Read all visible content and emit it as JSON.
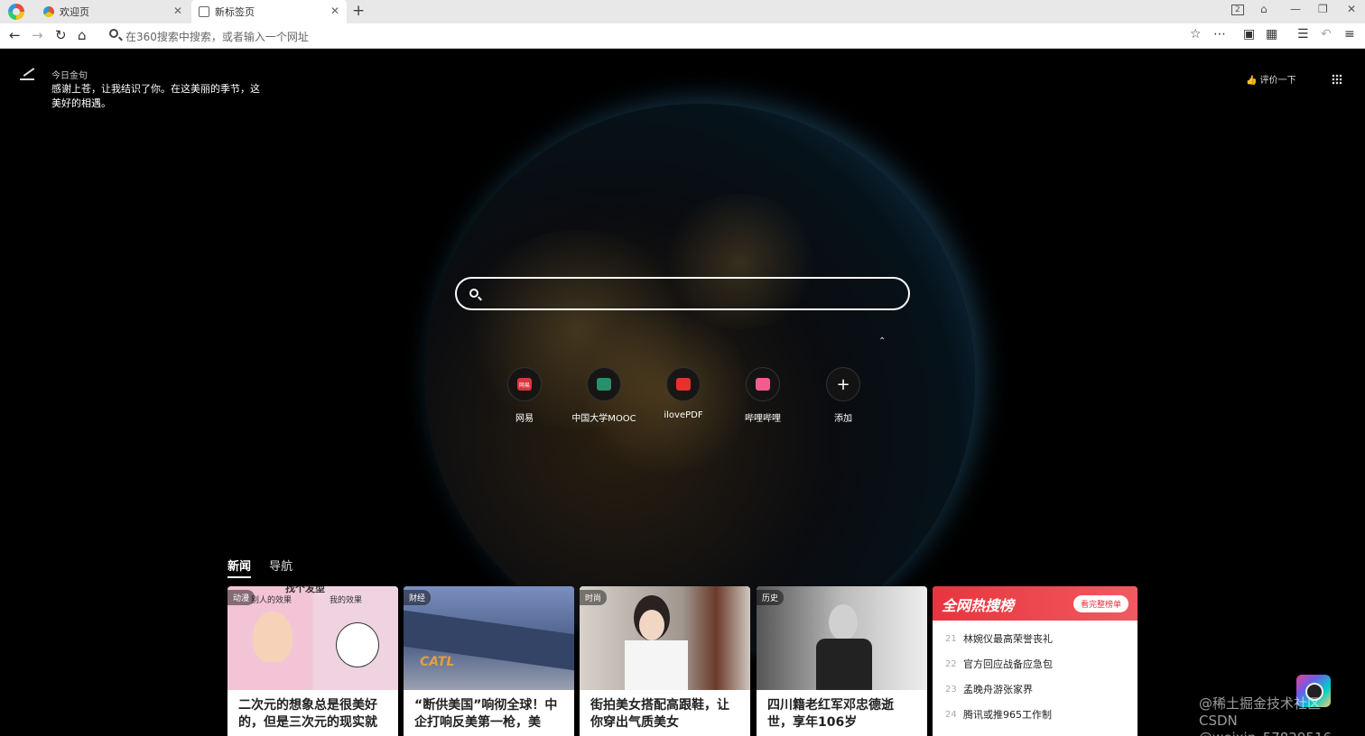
{
  "browser": {
    "tabs": [
      {
        "title": "欢迎页"
      },
      {
        "title": "新标签页"
      }
    ],
    "new_tab": "+",
    "tab_count": "2",
    "address_placeholder": "在360搜索中搜索，或者输入一个网址"
  },
  "quote": {
    "title": "今日金句",
    "text": "感谢上苍，让我结识了你。在这美丽的季节，这美好的相遇。"
  },
  "header": {
    "rate": "评价一下"
  },
  "shortcuts": [
    {
      "label": "网易",
      "icon": "netease-icon",
      "color": "#d9363e",
      "mark": "网易"
    },
    {
      "label": "中国大学MOOC",
      "icon": "mooc-icon",
      "color": "#2a8f6a",
      "mark": ""
    },
    {
      "label": "ilovePDF",
      "icon": "ilovepdf-icon",
      "color": "#e5322d",
      "mark": ""
    },
    {
      "label": "哔哩哔哩",
      "icon": "bilibili-icon",
      "color": "#f25d8e",
      "mark": ""
    },
    {
      "label": "添加",
      "icon": "add-icon",
      "color": "",
      "mark": "+"
    }
  ],
  "feed_tabs": [
    "新闻",
    "导航"
  ],
  "cards": [
    {
      "badge": "动漫",
      "title": "二次元的想象总是很美好的，但是三次元的现实就",
      "img_color": "#f1c9da",
      "caption_top": "找个发型",
      "caption_l": "别人的效果",
      "caption_r": "我的效果"
    },
    {
      "badge": "财经",
      "title": "“断供美国”响彻全球！中企打响反美第一枪，美",
      "img_color": "#5a6f9a",
      "sign": "CATL"
    },
    {
      "badge": "时尚",
      "title": "街拍美女搭配高跟鞋，让你穿出气质美女",
      "img_color": "#bdb6ae"
    },
    {
      "badge": "历史",
      "title": "四川籍老红军邓忠德逝世，享年106岁",
      "img_color": "#8c8c8c"
    }
  ],
  "hot": {
    "title": "全网热搜榜",
    "button": "看完整榜单",
    "items": [
      {
        "rank": "21",
        "text": "林婉仪最高荣誉丧礼"
      },
      {
        "rank": "22",
        "text": "官方回应战备应急包"
      },
      {
        "rank": "23",
        "text": "孟晚舟游张家界"
      },
      {
        "rank": "24",
        "text": "腾讯或推965工作制"
      }
    ]
  },
  "watermark": {
    "line1": "@稀土掘金技术社区",
    "line2": "CSDN @weixin_57829516"
  }
}
